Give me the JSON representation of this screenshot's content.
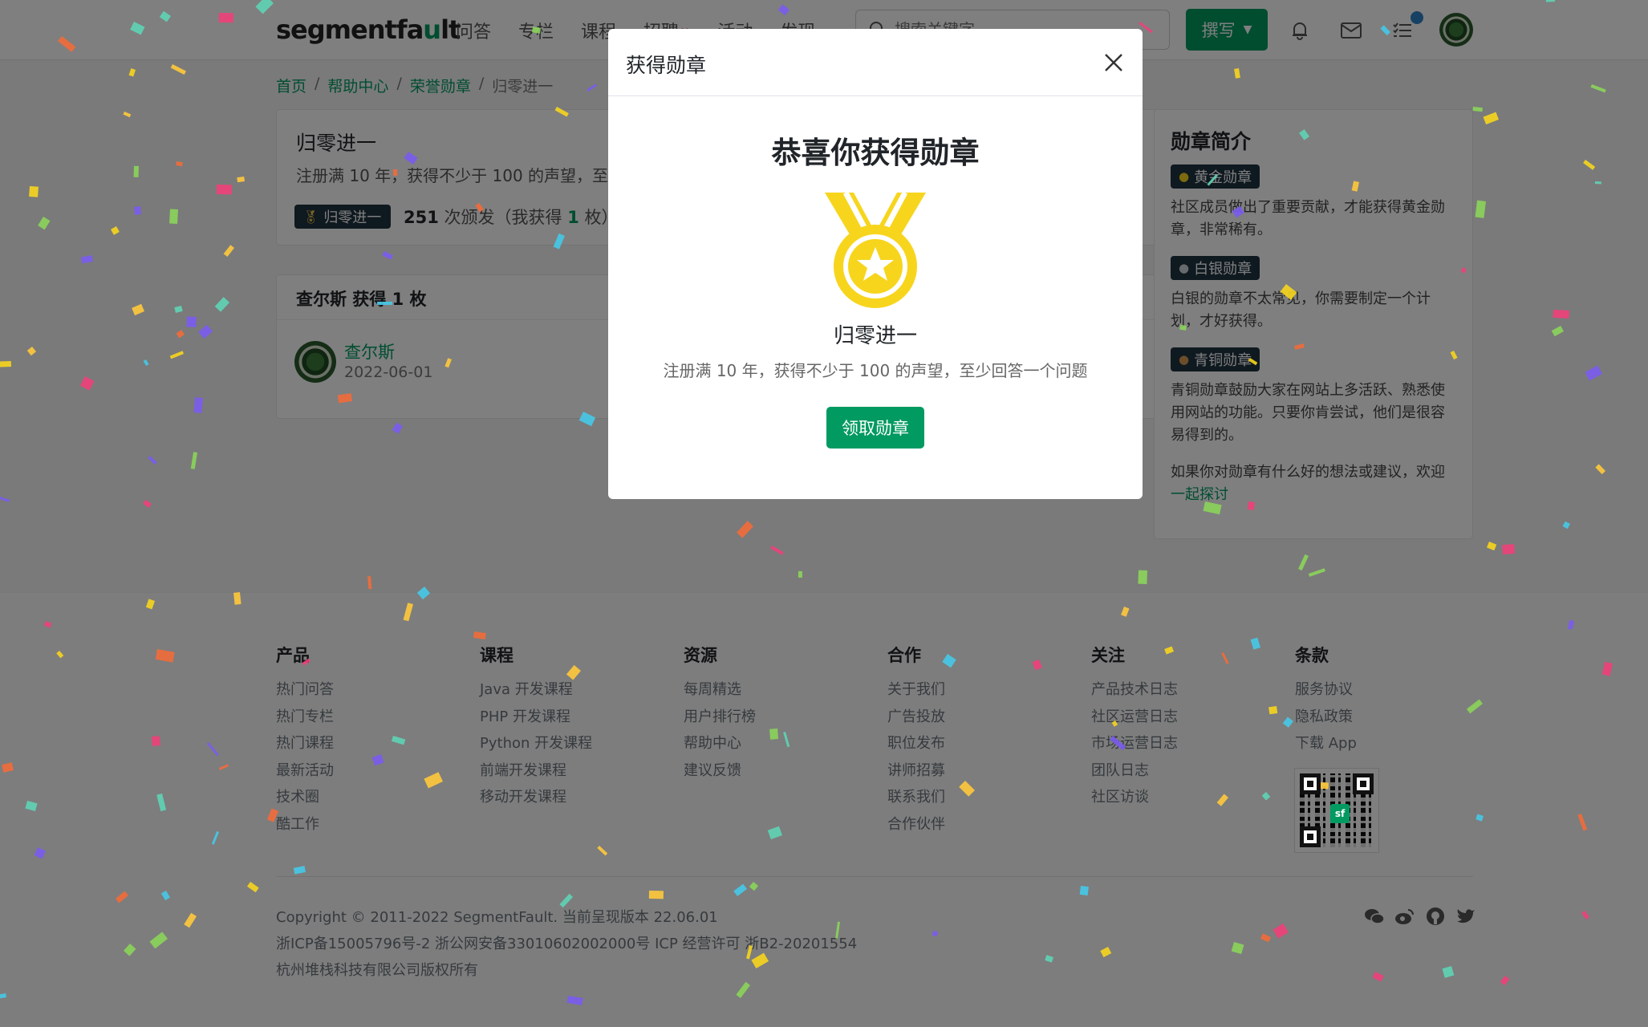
{
  "nav": {
    "logo_main": "segmentfa",
    "logo_accent": "u",
    "logo_end": "lt",
    "links": [
      "问答",
      "专栏",
      "课程",
      "招聘",
      "活动",
      "发现"
    ],
    "search_placeholder": "搜索关键字",
    "write_label": "撰写"
  },
  "breadcrumb": {
    "items": [
      "首页",
      "帮助中心",
      "荣誉勋章",
      "归零进一"
    ],
    "sep": "/"
  },
  "badge": {
    "title": "归零进一",
    "desc": "注册满 10 年，获得不少于 100 的声望，至少回答一个问题",
    "chip": "归零进一",
    "count": "251",
    "count_text": "次颁发（我获得",
    "mine": "1",
    "mine_unit": "枚）"
  },
  "owner": {
    "header": "查尔斯 获得 1 枚",
    "name": "查尔斯",
    "date": "2022-06-01"
  },
  "intro": {
    "title": "勋章简介",
    "gold_label": "黄金勋章",
    "gold_text": "社区成员做出了重要贡献，才能获得黄金勋章，非常稀有。",
    "silver_label": "白银勋章",
    "silver_text": "白银的勋章不太常见，你需要制定一个计划，才好获得。",
    "bronze_label": "青铜勋章",
    "bronze_text": "青铜勋章鼓励大家在网站上多活跃、熟悉使用网站的功能。只要你肯尝试，他们是很容易得到的。",
    "feedback_text": "如果你对勋章有什么好的想法或建议，欢迎",
    "feedback_link": "一起探讨"
  },
  "footer": {
    "columns": [
      {
        "title": "产品",
        "items": [
          "热门问答",
          "热门专栏",
          "热门课程",
          "最新活动",
          "技术圈",
          "酷工作"
        ]
      },
      {
        "title": "课程",
        "items": [
          "Java 开发课程",
          "PHP 开发课程",
          "Python 开发课程",
          "前端开发课程",
          "移动开发课程"
        ]
      },
      {
        "title": "资源",
        "items": [
          "每周精选",
          "用户排行榜",
          "帮助中心",
          "建议反馈"
        ]
      },
      {
        "title": "合作",
        "items": [
          "关于我们",
          "广告投放",
          "职位发布",
          "讲师招募",
          "联系我们",
          "合作伙伴"
        ]
      },
      {
        "title": "关注",
        "items": [
          "产品技术日志",
          "社区运营日志",
          "市场运营日志",
          "团队日志",
          "社区访谈"
        ]
      },
      {
        "title": "条款",
        "items": [
          "服务协议",
          "隐私政策",
          "下载 App"
        ]
      }
    ],
    "copyright": "Copyright © 2011-2022 SegmentFault. 当前呈现版本 22.06.01",
    "icp": "浙ICP备15005796号-2  浙公网安备33010602002000号  ICP 经营许可 浙B2-20201554",
    "company": "杭州堆栈科技有限公司版权所有",
    "qr_logo": "sf"
  },
  "modal": {
    "title": "获得勋章",
    "heading": "恭喜你获得勋章",
    "badge_name": "归零进一",
    "badge_desc": "注册满 10 年，获得不少于 100 的声望，至少回答一个问题",
    "claim_label": "领取勋章"
  },
  "colors": {
    "brand": "#019a61",
    "medal": "#f7d51d",
    "chip_bg": "#1f3340"
  }
}
